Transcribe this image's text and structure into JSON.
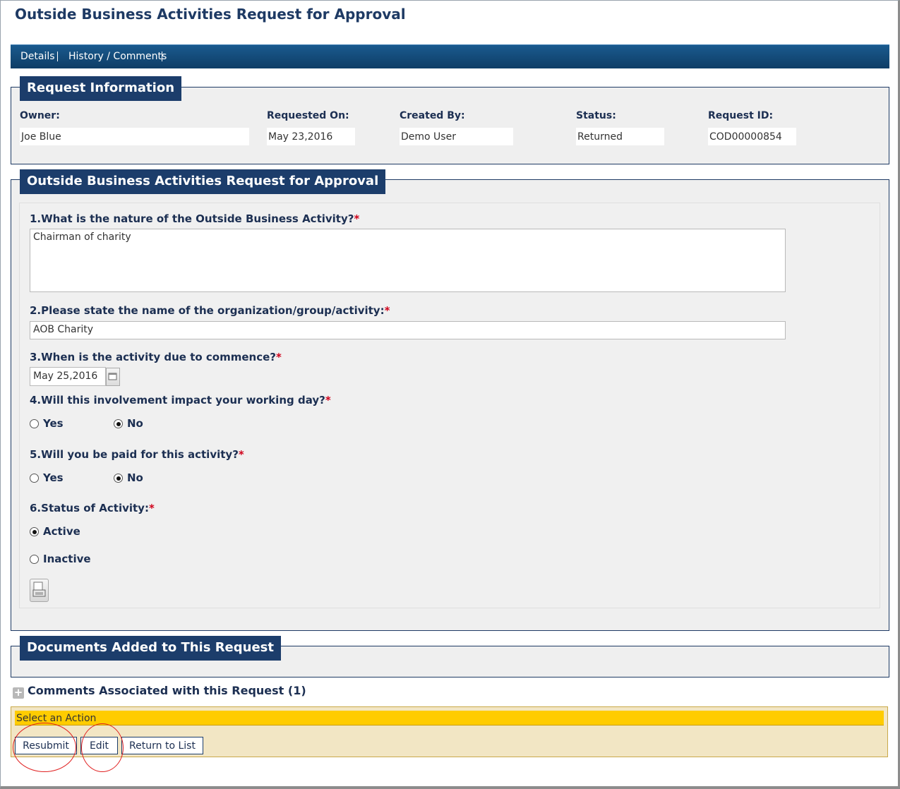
{
  "page": {
    "title": "Outside Business Activities Request for Approval"
  },
  "nav": {
    "items": [
      {
        "label": "Details"
      },
      {
        "label": "History / Comments"
      }
    ]
  },
  "request_info": {
    "legend": "Request Information",
    "owner_label": "Owner:",
    "owner_value": "Joe Blue",
    "requested_on_label": "Requested On:",
    "requested_on_value": "May 23,2016",
    "created_by_label": "Created By:",
    "created_by_value": "Demo User",
    "status_label": "Status:",
    "status_value": "Returned",
    "request_id_label": "Request ID:",
    "request_id_value": "COD00000854"
  },
  "form": {
    "legend": "Outside Business Activities Request for Approval",
    "required_marker": "*",
    "q1": {
      "label": "1.What is the nature of the Outside Business Activity?",
      "value": "Chairman of charity"
    },
    "q2": {
      "label": "2.Please state the name of the organization/group/activity:",
      "value": "AOB Charity"
    },
    "q3": {
      "label": "3.When is the activity due to commence?",
      "value": "May 25,2016"
    },
    "q4": {
      "label": "4.Will this involvement impact your working day?",
      "options": [
        "Yes",
        "No"
      ],
      "selected": "No"
    },
    "q5": {
      "label": "5.Will you be paid for this activity?",
      "options": [
        "Yes",
        "No"
      ],
      "selected": "No"
    },
    "q6": {
      "label": "6.Status of Activity:",
      "options": [
        "Active",
        "Inactive"
      ],
      "selected": "Active"
    }
  },
  "documents": {
    "legend": "Documents Added to This Request"
  },
  "comments": {
    "label": "Comments Associated with this Request (1)"
  },
  "actions": {
    "header": "Select an Action",
    "resubmit": "Resubmit",
    "edit": "Edit",
    "return_to_list": "Return to List"
  },
  "colors": {
    "brand": "#1c3d6b",
    "action_bar": "#ffcc00",
    "required": "#d0021b"
  }
}
